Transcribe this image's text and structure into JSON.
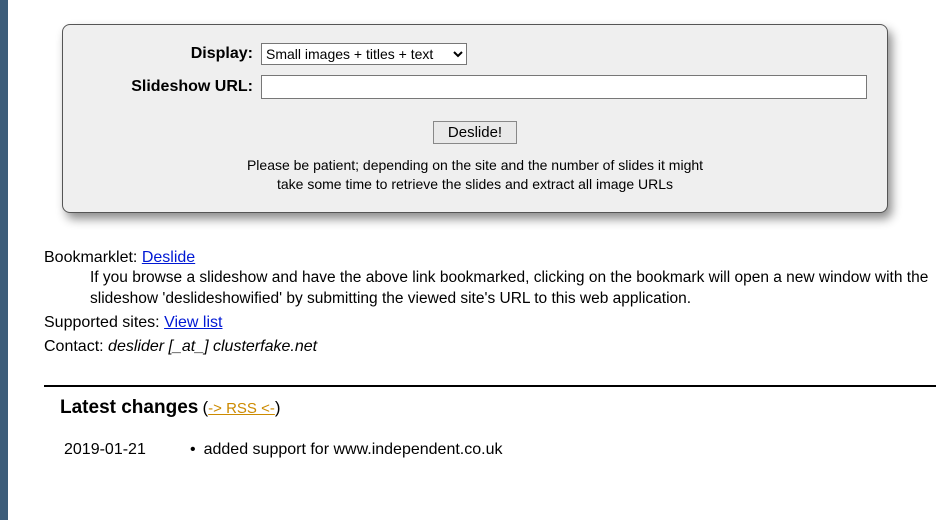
{
  "form": {
    "display_label": "Display:",
    "display_selected": "Small images + titles + text",
    "url_label": "Slideshow URL:",
    "url_value": "",
    "submit_label": "Deslide!",
    "hint_line1": "Please be patient; depending on the site and the number of slides it might",
    "hint_line2": "take some time to retrieve the slides and extract all image URLs"
  },
  "info": {
    "bookmarklet_label": "Bookmarklet:",
    "bookmarklet_link": "Deslide",
    "bookmarklet_desc": "If you browse a slideshow and have the above link bookmarked, clicking on the bookmark will open a new window with the slideshow 'deslideshowified' by submitting the viewed site's URL to this web application.",
    "supported_label": "Supported sites:",
    "supported_link": "View list",
    "contact_label": "Contact:",
    "contact_value": "deslider [_at_] clusterfake.net"
  },
  "changes": {
    "heading": "Latest changes",
    "rss_text": "-> RSS <-",
    "items": [
      {
        "date": "2019-01-21",
        "text": "added support for www.independent.co.uk"
      }
    ]
  }
}
